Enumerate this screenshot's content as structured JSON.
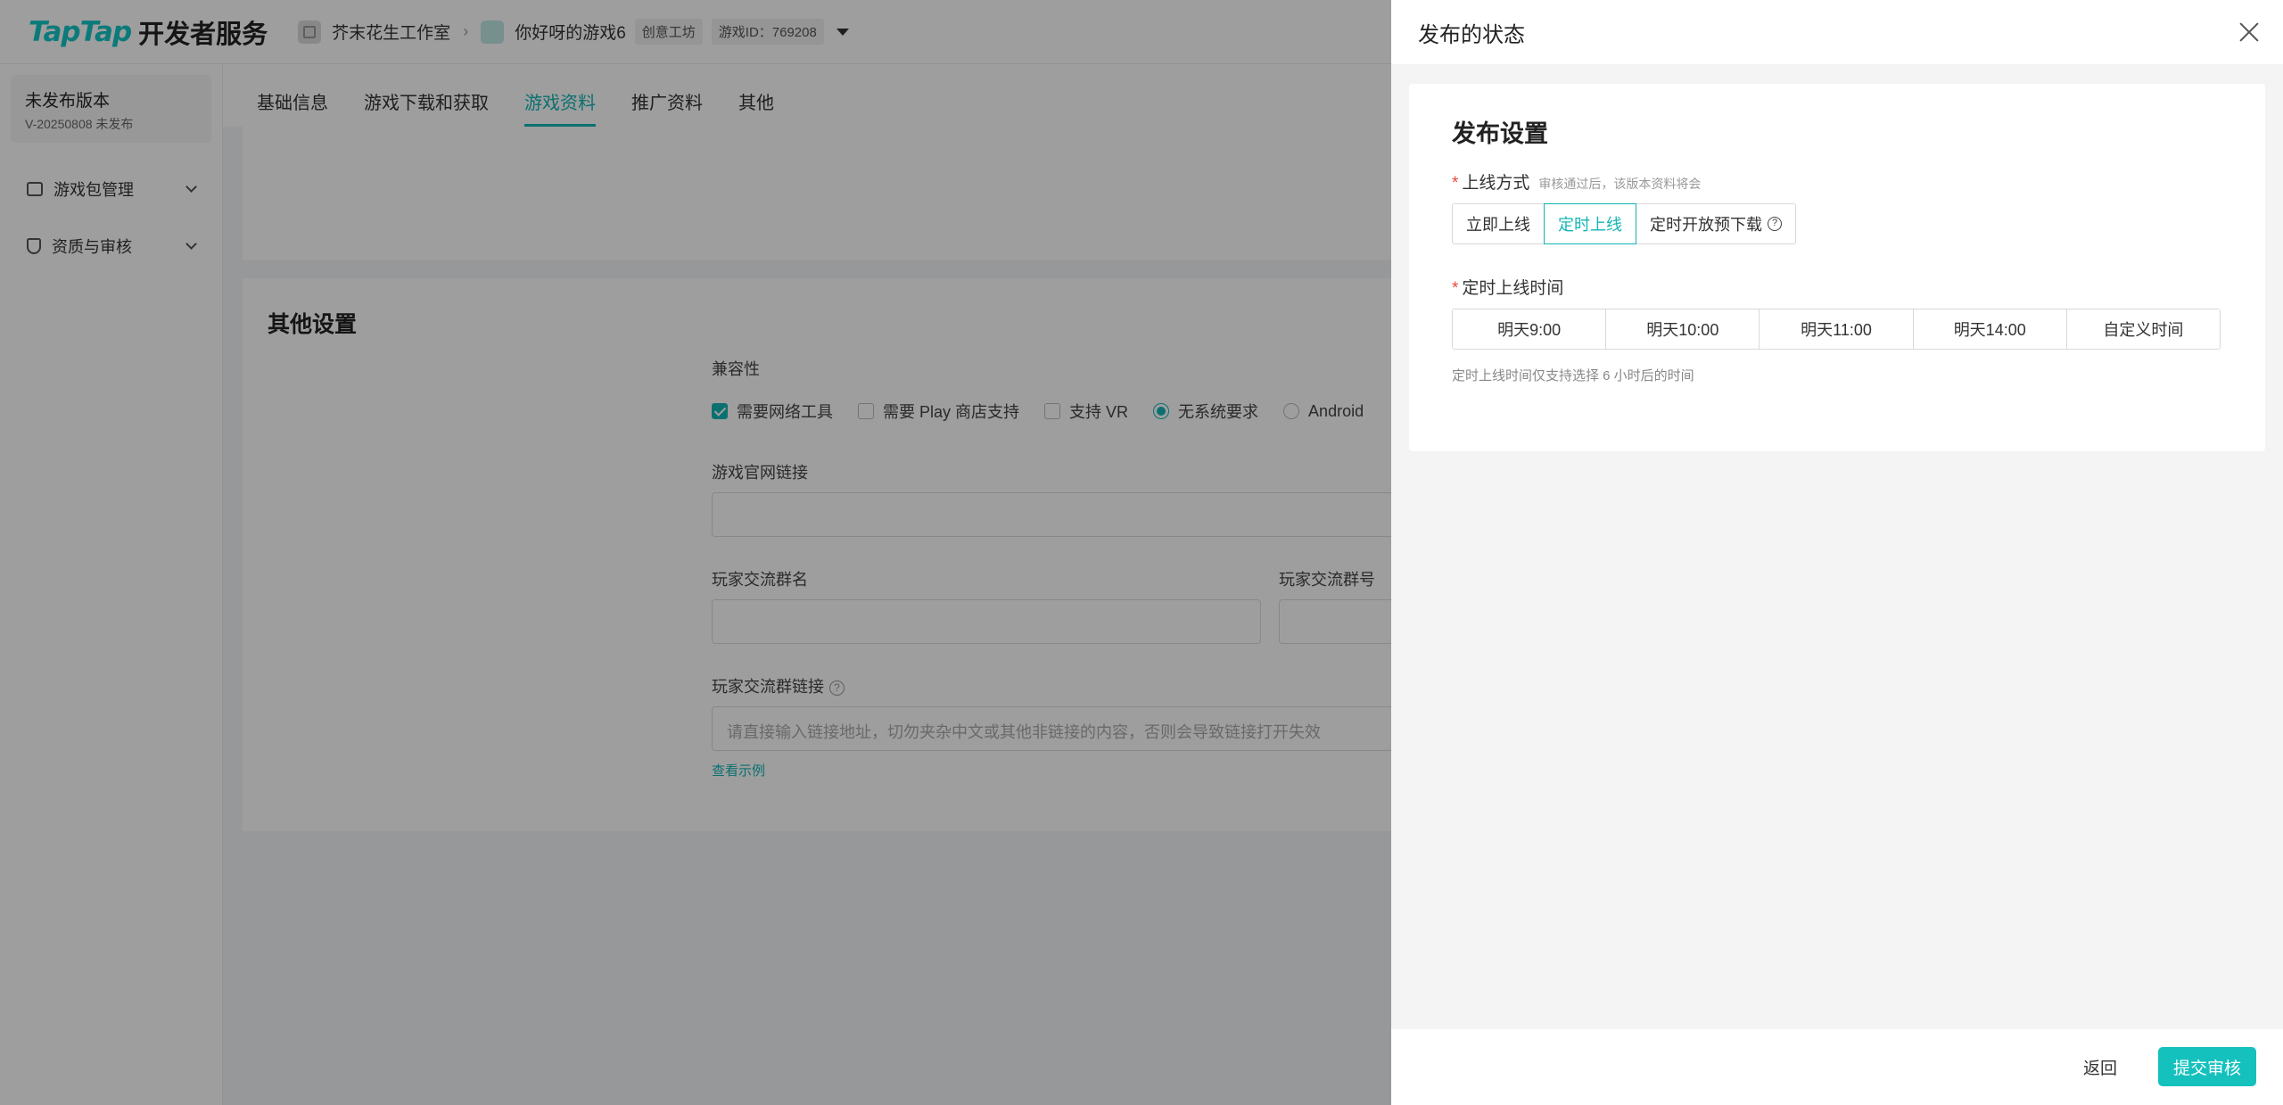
{
  "topbar": {
    "logo_brand": "TapTap",
    "logo_suffix": "开发者服务",
    "studio": "芥末花生工作室",
    "game": "你好呀的游戏6",
    "tag_workshop": "创意工坊",
    "game_id": "游戏ID：769208"
  },
  "sidebar": {
    "version_title": "未发布版本",
    "version_sub": "V-20250808 未发布",
    "items": [
      {
        "label": "游戏包管理"
      },
      {
        "label": "资质与审核"
      }
    ]
  },
  "tabs": [
    {
      "label": "基础信息"
    },
    {
      "label": "游戏下载和获取"
    },
    {
      "label": "游戏资料"
    },
    {
      "label": "推广资料"
    },
    {
      "label": "其他"
    }
  ],
  "active_tab": "游戏资料",
  "other_settings": {
    "title": "其他设置",
    "compat_label": "兼容性",
    "compat_options": [
      {
        "label": "需要网络工具",
        "checked": true
      },
      {
        "label": "需要 Play 商店支持",
        "checked": false
      },
      {
        "label": "支持 VR",
        "checked": false
      }
    ],
    "radio_options": [
      {
        "label": "无系统要求",
        "selected": true
      },
      {
        "label": "Android",
        "selected": false
      }
    ],
    "website_label": "游戏官网链接",
    "group_name_label": "玩家交流群名",
    "group_number_label": "玩家交流群号",
    "group_link_label": "玩家交流群链接",
    "group_link_placeholder": "请直接输入链接地址，切勿夹杂中文或其他非链接的内容，否则会导致链接打开失效",
    "example_link": "查看示例"
  },
  "drawer": {
    "title": "发布的状态",
    "section_title": "发布设置",
    "launch_mode_label": "上线方式",
    "launch_mode_hint": "审核通过后，该版本资料将会",
    "launch_modes": [
      {
        "label": "立即上线",
        "active": false
      },
      {
        "label": "定时上线",
        "active": true
      },
      {
        "label": "定时开放预下载",
        "active": false
      }
    ],
    "schedule_label": "定时上线时间",
    "time_options": [
      "明天9:00",
      "明天10:00",
      "明天11:00",
      "明天14:00",
      "自定义时间"
    ],
    "note": "定时上线时间仅支持选择 6 小时后的时间",
    "back_label": "返回",
    "submit_label": "提交审核"
  },
  "colors": {
    "accent": "#14b5b5",
    "primary_button": "#14c1bd",
    "required": "#e84a3f"
  }
}
